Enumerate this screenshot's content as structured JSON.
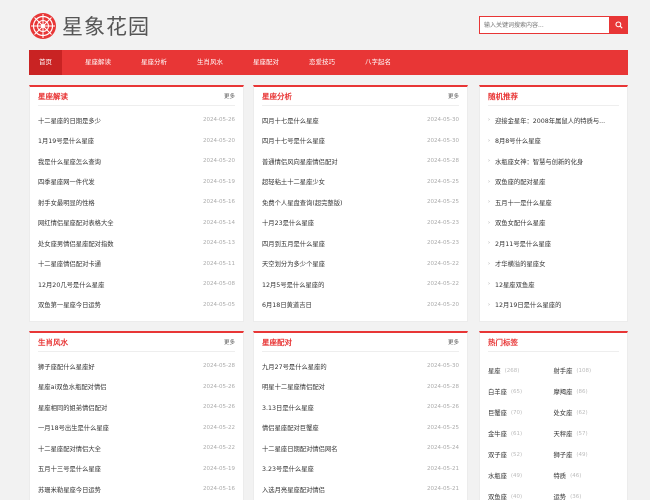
{
  "site": {
    "name": "星象花园",
    "colors": {
      "accent": "#e83636",
      "nav_active": "#c92323"
    }
  },
  "search": {
    "placeholder": "输入关键词搜索内容..."
  },
  "nav": {
    "items": [
      "首页",
      "星座解读",
      "星座分析",
      "生肖风水",
      "星座配对",
      "恋爱技巧",
      "八字起名"
    ],
    "active": "首页"
  },
  "panels": {
    "jiedu": {
      "title": "星座解读",
      "more": "更多",
      "items": [
        {
          "title": "十二星座的日期是多少",
          "date": "2024-05-26"
        },
        {
          "title": "1月19号是什么星座",
          "date": "2024-05-20"
        },
        {
          "title": "我是什么星座怎么查询",
          "date": "2024-05-20"
        },
        {
          "title": "四季星座网一件代发",
          "date": "2024-05-19"
        },
        {
          "title": "射手女最明显的性格",
          "date": "2024-05-16"
        },
        {
          "title": "网红情侣星座配对表格大全",
          "date": "2024-05-14"
        },
        {
          "title": "处女座男情侣星座配对指数",
          "date": "2024-05-13"
        },
        {
          "title": "十二星座情侣配对卡通",
          "date": "2024-05-11"
        },
        {
          "title": "12月20几号是什么星座",
          "date": "2024-05-08"
        },
        {
          "title": "双鱼第一星座今日运势",
          "date": "2024-05-05"
        }
      ]
    },
    "fenxi": {
      "title": "星座分析",
      "more": "更多",
      "items": [
        {
          "title": "四月十七是什么星座",
          "date": "2024-05-30"
        },
        {
          "title": "四月十七号是什么星座",
          "date": "2024-05-30"
        },
        {
          "title": "普通情侣风向星座情侣配对",
          "date": "2024-05-28"
        },
        {
          "title": "超轻粘土十二星座少女",
          "date": "2024-05-25"
        },
        {
          "title": "免费个人星盘查询(超完整版)",
          "date": "2024-05-25"
        },
        {
          "title": "十月23是什么星座",
          "date": "2024-05-23"
        },
        {
          "title": "四月到五月是什么星座",
          "date": "2024-05-23"
        },
        {
          "title": "天空划分为多少个星座",
          "date": "2024-05-22"
        },
        {
          "title": "12月5号是什么星座的",
          "date": "2024-05-22"
        },
        {
          "title": "6月18日黄道吉日",
          "date": "2024-05-20"
        }
      ]
    },
    "tuijian": {
      "title": "随机推荐",
      "items": [
        "迎接金星年：2008年属鼠人的特质与...",
        "8月8号什么星座",
        "水瓶座女神：智慧与创新的化身",
        "双鱼座的配对星座",
        "五月十一是什么星座",
        "双鱼女配什么星座",
        "2月11号是什么星座",
        "才华横溢的星座女",
        "12星座双鱼座",
        "12月19日是什么星座的"
      ]
    },
    "fengshui": {
      "title": "生肖风水",
      "more": "更多",
      "items": [
        {
          "title": "狮子座配什么星座好",
          "date": "2024-05-28"
        },
        {
          "title": "星座ai双鱼水瓶配对情侣",
          "date": "2024-05-26"
        },
        {
          "title": "星座相同的姐弟情侣配对",
          "date": "2024-05-26"
        },
        {
          "title": "一月18号出生是什么星座",
          "date": "2024-05-22"
        },
        {
          "title": "十二星座配对情侣大全",
          "date": "2024-05-22"
        },
        {
          "title": "五月十三号是什么星座",
          "date": "2024-05-19"
        },
        {
          "title": "苏珊米勒星座今日运势",
          "date": "2024-05-16"
        }
      ]
    },
    "peidui": {
      "title": "星座配对",
      "more": "更多",
      "items": [
        {
          "title": "九月27号是什么星座的",
          "date": "2024-05-30"
        },
        {
          "title": "明星十二星座情侣配对",
          "date": "2024-05-28"
        },
        {
          "title": "3.13日是什么星座",
          "date": "2024-05-26"
        },
        {
          "title": "情侣星座配对巨蟹座",
          "date": "2024-05-25"
        },
        {
          "title": "十二星座日期配对情侣网名",
          "date": "2024-05-24"
        },
        {
          "title": "3.23号是什么星座",
          "date": "2024-05-21"
        },
        {
          "title": "入选月亮星座配对情侣",
          "date": "2024-05-21"
        }
      ]
    },
    "tags": {
      "title": "热门标签",
      "items": [
        {
          "name": "星座",
          "count": "(268)"
        },
        {
          "name": "射手座",
          "count": "(108)"
        },
        {
          "name": "白羊座",
          "count": "(65)"
        },
        {
          "name": "摩羯座",
          "count": "(86)"
        },
        {
          "name": "巨蟹座",
          "count": "(70)"
        },
        {
          "name": "处女座",
          "count": "(62)"
        },
        {
          "name": "金牛座",
          "count": "(61)"
        },
        {
          "name": "天秤座",
          "count": "(57)"
        },
        {
          "name": "双子座",
          "count": "(52)"
        },
        {
          "name": "狮子座",
          "count": "(49)"
        },
        {
          "name": "水瓶座",
          "count": "(49)"
        },
        {
          "name": "特质",
          "count": "(46)"
        },
        {
          "name": "双鱼座",
          "count": "(40)"
        },
        {
          "name": "运势",
          "count": "(36)"
        }
      ]
    }
  }
}
